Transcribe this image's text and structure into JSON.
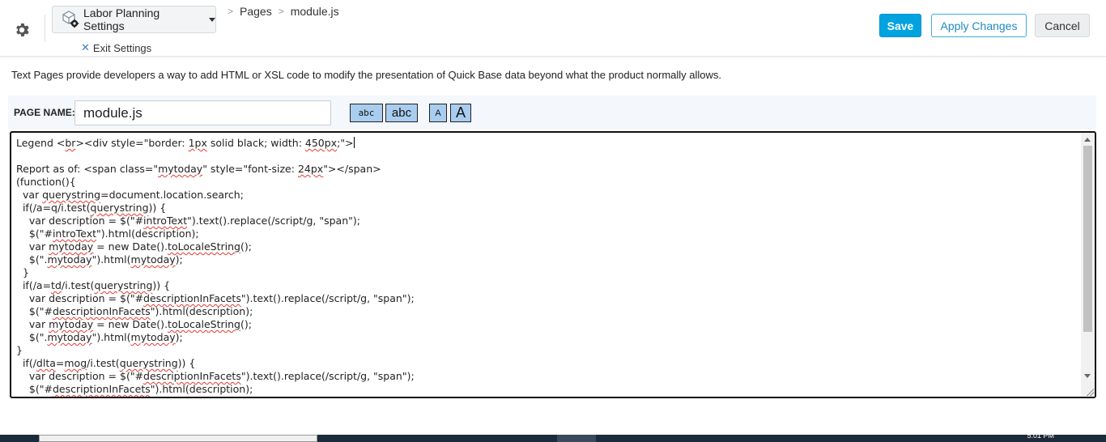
{
  "header": {
    "app_name": "Labor Planning Settings",
    "exit_label": "Exit Settings",
    "breadcrumb": [
      "Pages",
      "module.js"
    ],
    "buttons": {
      "save": "Save",
      "apply": "Apply Changes",
      "cancel": "Cancel"
    },
    "colors": {
      "save_bg": "#00a3e0",
      "apply_text": "#1f8ac0",
      "cancel_bg": "#eceeef"
    }
  },
  "intro_text": "Text Pages provide developers a way to add HTML or XSL code to modify the presentation of Quick Base data beyond what the product normally allows.",
  "page_name": {
    "label": "PAGE NAME:",
    "value": "module.js"
  },
  "font_buttons": {
    "mono_label": "abc",
    "sans_label": "abc",
    "small_a": "A",
    "large_a": "A"
  },
  "editor": {
    "lines": [
      "Legend <br><div style=\"border: 1px solid black; width: 450px;\">",
      "",
      "Report as of: <span class=\"mytoday\" style=\"font-size: 24px\"></span>",
      "(function(){",
      "  var querystring=document.location.search;",
      "  if(/a=q/i.test(querystring)) {",
      "    var description = $(\"#introText\").text().replace(/script/g, \"span\");",
      "    $(\"#introText\").html(description);",
      "    var mytoday = new Date().toLocaleString();",
      "    $(\".mytoday\").html(mytoday);",
      "  }",
      "  if(/a=td/i.test(querystring)) {",
      "    var description = $(\"#descriptionInFacets\").text().replace(/script/g, \"span\");",
      "    $(\"#descriptionInFacets\").html(description);",
      "    var mytoday = new Date().toLocaleString();",
      "    $(\".mytoday\").html(mytoday);",
      "}",
      "  if(/dlta=mog/i.test(querystring)) {",
      "    var description = $(\"#descriptionInFacets\").text().replace(/script/g, \"span\");",
      "    $(\"#descriptionInFacets\").html(description);"
    ],
    "spellcheck_words": [
      "br",
      "1px",
      "450px",
      "mytoday",
      "24px",
      "querystring",
      "introText",
      "td",
      "descriptionInFacets",
      "toLocaleString",
      "dlta",
      "mog"
    ]
  },
  "taskbar": {
    "clock": "5:01 PM"
  }
}
